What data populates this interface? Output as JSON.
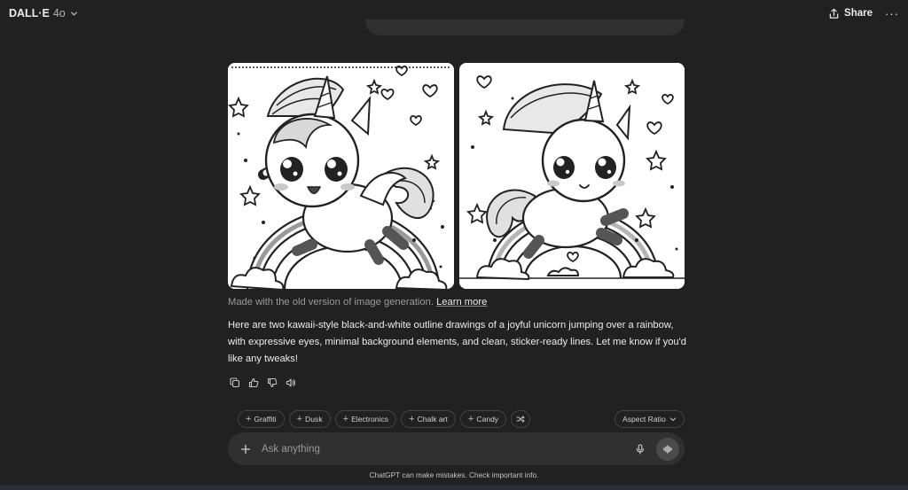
{
  "header": {
    "model_name": "DALL·E",
    "model_version": "4o",
    "share_label": "Share",
    "more_label": "···"
  },
  "gallery": {
    "images": [
      {
        "subject": "unicorn-over-rainbow-coloring-page-1"
      },
      {
        "subject": "unicorn-over-rainbow-coloring-page-2"
      }
    ]
  },
  "message": {
    "notice_text": "Made with the old version of image generation.",
    "notice_link": "Learn more",
    "reply_text": "Here are two kawaii-style black-and-white outline drawings of a joyful unicorn jumping over a rainbow, with expressive eyes, minimal background elements, and clean, sticker-ready lines. Let me know if you'd like any tweaks!"
  },
  "message_actions": [
    {
      "icon": "copy-icon"
    },
    {
      "icon": "thumbs-up-icon"
    },
    {
      "icon": "thumbs-down-icon"
    },
    {
      "icon": "read-aloud-icon"
    }
  ],
  "style_chips": {
    "items": [
      {
        "label": "Graffiti"
      },
      {
        "label": "Dusk"
      },
      {
        "label": "Electronics"
      },
      {
        "label": "Chalk art"
      },
      {
        "label": "Candy"
      }
    ],
    "shuffle_icon": "shuffle-icon",
    "aspect_ratio_label": "Aspect Ratio"
  },
  "composer": {
    "placeholder": "Ask anything"
  },
  "footer": {
    "disclaimer": "ChatGPT can make mistakes. Check important info."
  },
  "colors": {
    "background": "#212121",
    "surface": "#303030",
    "text": "#ececec",
    "muted_text": "#9b9b9b"
  }
}
